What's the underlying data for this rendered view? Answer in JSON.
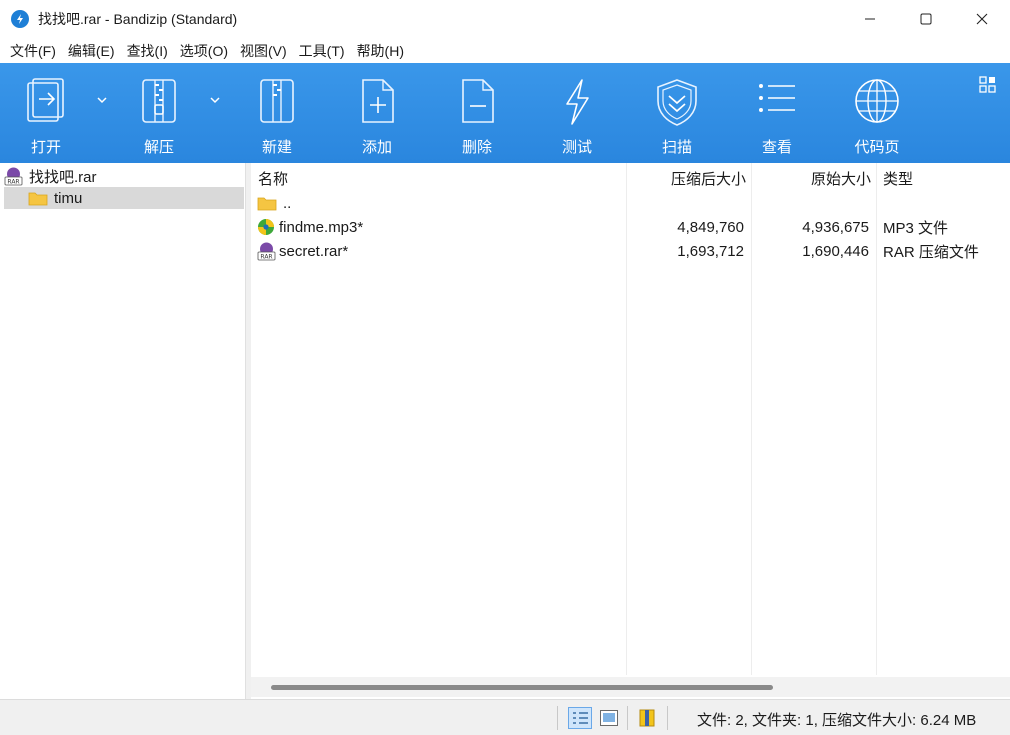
{
  "window": {
    "title": "找找吧.rar - Bandizip (Standard)"
  },
  "menu": [
    "文件(F)",
    "编辑(E)",
    "查找(I)",
    "选项(O)",
    "视图(V)",
    "工具(T)",
    "帮助(H)"
  ],
  "toolbar": {
    "open": "打开",
    "extract": "解压",
    "new": "新建",
    "add": "添加",
    "delete": "删除",
    "test": "测试",
    "scan": "扫描",
    "view": "查看",
    "codepage": "代码页"
  },
  "tree": {
    "root": "找找吧.rar",
    "folder": "timu"
  },
  "columns": {
    "name": "名称",
    "packed": "压缩后大小",
    "original": "原始大小",
    "type": "类型"
  },
  "files": [
    {
      "name": "..",
      "packed": "",
      "original": "",
      "type": ""
    },
    {
      "name": "findme.mp3*",
      "packed": "4,849,760",
      "original": "4,936,675",
      "type": "MP3 文件"
    },
    {
      "name": "secret.rar*",
      "packed": "1,693,712",
      "original": "1,690,446",
      "type": "RAR 压缩文件"
    }
  ],
  "status": {
    "text": "文件: 2, 文件夹: 1, 压缩文件大小: 6.24 MB"
  },
  "colors": {
    "toolbar_blue": "#2f8de4",
    "selection_gray": "#d9d9d9",
    "folder_yellow": "#f5c542"
  }
}
